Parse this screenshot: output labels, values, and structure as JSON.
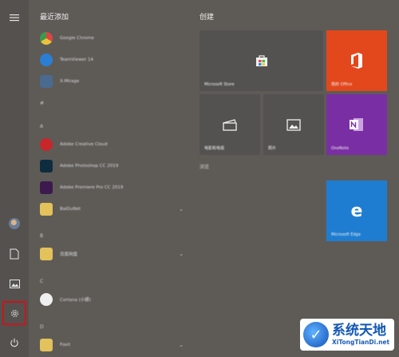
{
  "start_menu": {
    "list_header": "最近添加",
    "group_header": "创建",
    "blur_letters": [
      "最近添加",
      "#",
      "A",
      "B",
      "C",
      "D"
    ],
    "apps": [
      {
        "name": "Google Chrome",
        "icon": "chrome-icon",
        "color": "#d8a34a"
      },
      {
        "name": "TeamViewer 14",
        "icon": "teamviewer-icon",
        "color": "#2a7fd4"
      },
      {
        "name": "X-Mirage",
        "icon": "xmirage-icon",
        "color": "#4a6a90"
      },
      {
        "name": "Adobe Creative Cloud",
        "icon": "creative-cloud-icon",
        "color": "#c7262b"
      },
      {
        "name": "Adobe Photoshop CC 2019",
        "icon": "photoshop-icon",
        "color": "#0d2d3f"
      },
      {
        "name": "Adobe Premiere Pro CC 2019",
        "icon": "premiere-icon",
        "color": "#3c1a4d"
      },
      {
        "name": "BaiDuNet",
        "icon": "folder-icon",
        "color": "#e3c25b"
      },
      {
        "name": "百度网盘",
        "icon": "folder-icon",
        "color": "#e3c25b"
      },
      {
        "name": "Cortana (小娜)",
        "icon": "cortana-icon",
        "color": "#efefef"
      },
      {
        "name": "Foxit",
        "icon": "folder-icon",
        "color": "#e3c25b"
      }
    ],
    "tiles": [
      {
        "label": "Microsoft Store",
        "icon": "store-icon",
        "color": "#54524f"
      },
      {
        "label": "我的 Office",
        "icon": "office-icon",
        "color": "#e3471c"
      },
      {
        "label": "电影和电视",
        "icon": "film-icon",
        "color": "#54524f"
      },
      {
        "label": "照片",
        "icon": "photos-icon",
        "color": "#54524f"
      },
      {
        "label": "OneNote",
        "icon": "onenote-icon",
        "color": "#7a2ea3"
      },
      {
        "label": "Microsoft Edge",
        "icon": "edge-icon",
        "color": "#1f7dd1"
      }
    ],
    "section_label": "浏览"
  },
  "watermark": {
    "title": "系统天地",
    "url": "XiTongTianDi.net"
  }
}
